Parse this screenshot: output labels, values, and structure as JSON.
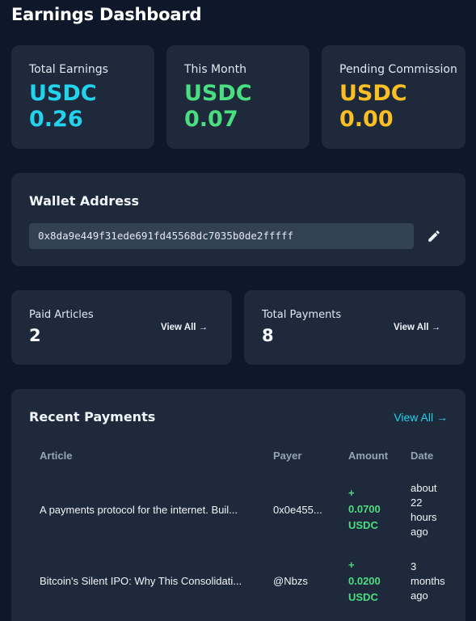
{
  "page": {
    "title": "Earnings Dashboard"
  },
  "stats": [
    {
      "label": "Total Earnings",
      "currency": "USDC",
      "amount": "0.26",
      "color": "#22d3ee"
    },
    {
      "label": "This Month",
      "currency": "USDC",
      "amount": "0.07",
      "color": "#4ade80"
    },
    {
      "label": "Pending Commission",
      "currency": "USDC",
      "amount": "0.00",
      "color": "#fbbf24"
    }
  ],
  "wallet": {
    "title": "Wallet Address",
    "address": "0x8da9e449f31ede691fd45568dc7035b0de2fffff",
    "edit_icon": "pencil-icon"
  },
  "summary": {
    "paid_articles": {
      "label": "Paid Articles",
      "value": "2",
      "link": "View All →"
    },
    "total_payments": {
      "label": "Total Payments",
      "value": "8",
      "link": "View All →"
    }
  },
  "recent_payments": {
    "title": "Recent Payments",
    "link": "View All →",
    "columns": [
      "Article",
      "Payer",
      "Amount",
      "Date"
    ],
    "rows": [
      {
        "article": "A payments protocol for the internet. Buil...",
        "payer": "0x0e455...",
        "amount_sign": "+",
        "amount_value": "0.0700",
        "amount_currency": "USDC",
        "date_lines": [
          "about",
          "22",
          "hours",
          "ago"
        ]
      },
      {
        "article": "Bitcoin's Silent IPO: Why This Consolidati...",
        "payer": "@Nbzs",
        "amount_sign": "+",
        "amount_value": "0.0200",
        "amount_currency": "USDC",
        "date_lines": [
          "3",
          "months",
          "ago"
        ]
      }
    ]
  },
  "colors": {
    "background": "#0f172a",
    "card": "#1e293b",
    "accent_cyan": "#22d3ee",
    "accent_green": "#4ade80",
    "accent_amber": "#fbbf24"
  }
}
